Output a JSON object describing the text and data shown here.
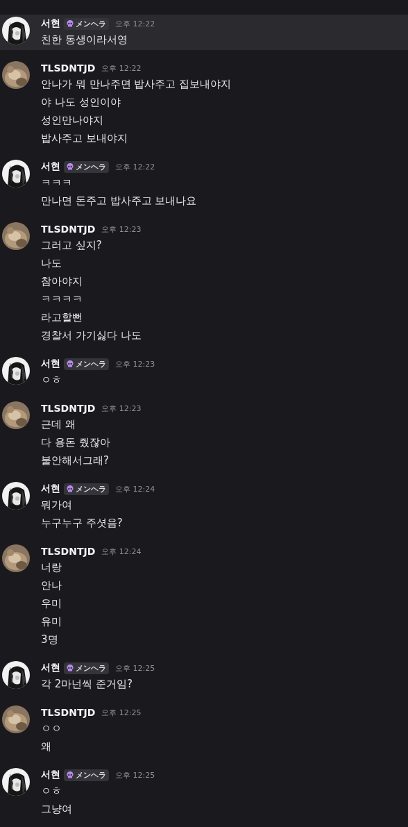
{
  "messages": [
    {
      "author": "서현",
      "kind": "mono",
      "badge": "メンヘラ",
      "time": "오후 12:22",
      "highlighted": true,
      "lines": [
        "친한 동생이라서영"
      ]
    },
    {
      "author": "TLSDNTJD",
      "time": "오후 12:22",
      "highlighted": false,
      "lines": [
        "안나가 뭐 만나주면 밥사주고 집보내야지",
        "야 나도 성인이야",
        "성인만나야지",
        "밥사주고 보내야지"
      ]
    },
    {
      "author": "서현",
      "kind": "mono",
      "badge": "メンヘラ",
      "time": "오후 12:22",
      "highlighted": false,
      "lines": [
        "ㅋㅋㅋ",
        "만나면 돈주고 밥사주고 보내나요"
      ]
    },
    {
      "author": "TLSDNTJD",
      "time": "오후 12:23",
      "highlighted": false,
      "lines": [
        "그러고 싶지?",
        "나도",
        "참아야지",
        "ㅋㅋㅋㅋ",
        "라고할뻔",
        "경찰서 가기싫다 나도"
      ]
    },
    {
      "author": "서현",
      "kind": "mono",
      "badge": "メンヘラ",
      "time": "오후 12:23",
      "highlighted": false,
      "lines": [
        "ㅇㅎ"
      ]
    },
    {
      "author": "TLSDNTJD",
      "time": "오후 12:23",
      "highlighted": false,
      "lines": [
        "근데 왜",
        "다 용돈 줬잖아",
        "불안해서그래?"
      ]
    },
    {
      "author": "서현",
      "kind": "mono",
      "badge": "メンヘラ",
      "time": "오후 12:24",
      "highlighted": false,
      "lines": [
        "뭐가여",
        "누구누구 주셧음?"
      ]
    },
    {
      "author": "TLSDNTJD",
      "time": "오후 12:24",
      "highlighted": false,
      "lines": [
        "너랑",
        "안나",
        "우미",
        "유미",
        "3명"
      ]
    },
    {
      "author": "서현",
      "kind": "mono",
      "badge": "メンヘラ",
      "time": "오후 12:25",
      "highlighted": false,
      "lines": [
        "각 2마넌씩 준거임?"
      ]
    },
    {
      "author": "TLSDNTJD",
      "time": "오후 12:25",
      "highlighted": false,
      "lines": [
        "ㅇㅇ",
        "왜"
      ]
    },
    {
      "author": "서현",
      "kind": "mono",
      "badge": "メンヘラ",
      "time": "오후 12:25",
      "highlighted": false,
      "lines": [
        "ㅇㅎ",
        "그냥여"
      ]
    }
  ]
}
